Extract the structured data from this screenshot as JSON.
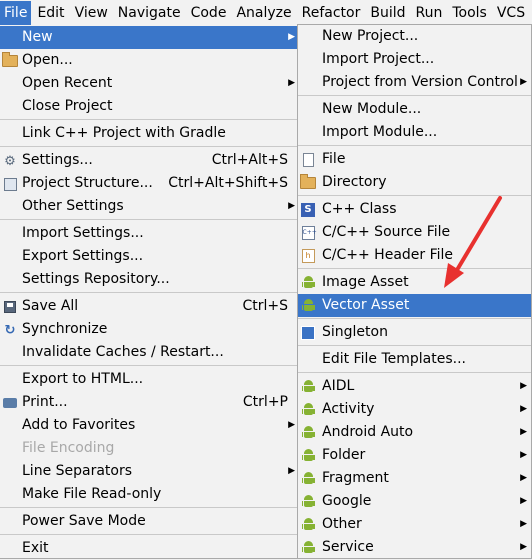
{
  "menubar": {
    "items": [
      {
        "label": "File"
      },
      {
        "label": "Edit"
      },
      {
        "label": "View"
      },
      {
        "label": "Navigate"
      },
      {
        "label": "Code"
      },
      {
        "label": "Analyze"
      },
      {
        "label": "Refactor"
      },
      {
        "label": "Build"
      },
      {
        "label": "Run"
      },
      {
        "label": "Tools"
      },
      {
        "label": "VCS"
      }
    ]
  },
  "file_menu": {
    "new": "New",
    "open": "Open...",
    "open_recent": "Open Recent",
    "close_project": "Close Project",
    "link_cpp": "Link C++ Project with Gradle",
    "settings": "Settings...",
    "settings_sc": "Ctrl+Alt+S",
    "project_structure": "Project Structure...",
    "project_structure_sc": "Ctrl+Alt+Shift+S",
    "other_settings": "Other Settings",
    "import_settings": "Import Settings...",
    "export_settings": "Export Settings...",
    "settings_repo": "Settings Repository...",
    "save_all": "Save All",
    "save_all_sc": "Ctrl+S",
    "synchronize": "Synchronize",
    "invalidate": "Invalidate Caches / Restart...",
    "export_html": "Export to HTML...",
    "print": "Print...",
    "print_sc": "Ctrl+P",
    "add_favorites": "Add to Favorites",
    "file_encoding": "File Encoding",
    "line_separators": "Line Separators",
    "make_readonly": "Make File Read-only",
    "power_save": "Power Save Mode",
    "exit": "Exit"
  },
  "new_submenu": {
    "new_project": "New Project...",
    "import_project": "Import Project...",
    "project_from_vcs": "Project from Version Control",
    "new_module": "New Module...",
    "import_module": "Import Module...",
    "file": "File",
    "directory": "Directory",
    "cpp_class": "C++ Class",
    "cpp_source": "C/C++ Source File",
    "cpp_header": "C/C++ Header File",
    "image_asset": "Image Asset",
    "vector_asset": "Vector Asset",
    "singleton": "Singleton",
    "edit_templates": "Edit File Templates...",
    "aidl": "AIDL",
    "activity": "Activity",
    "android_auto": "Android Auto",
    "folder": "Folder",
    "fragment": "Fragment",
    "google": "Google",
    "other": "Other",
    "service": "Service"
  },
  "colors": {
    "selection": "#3a76c9",
    "annotation_arrow": "#e8312f"
  }
}
